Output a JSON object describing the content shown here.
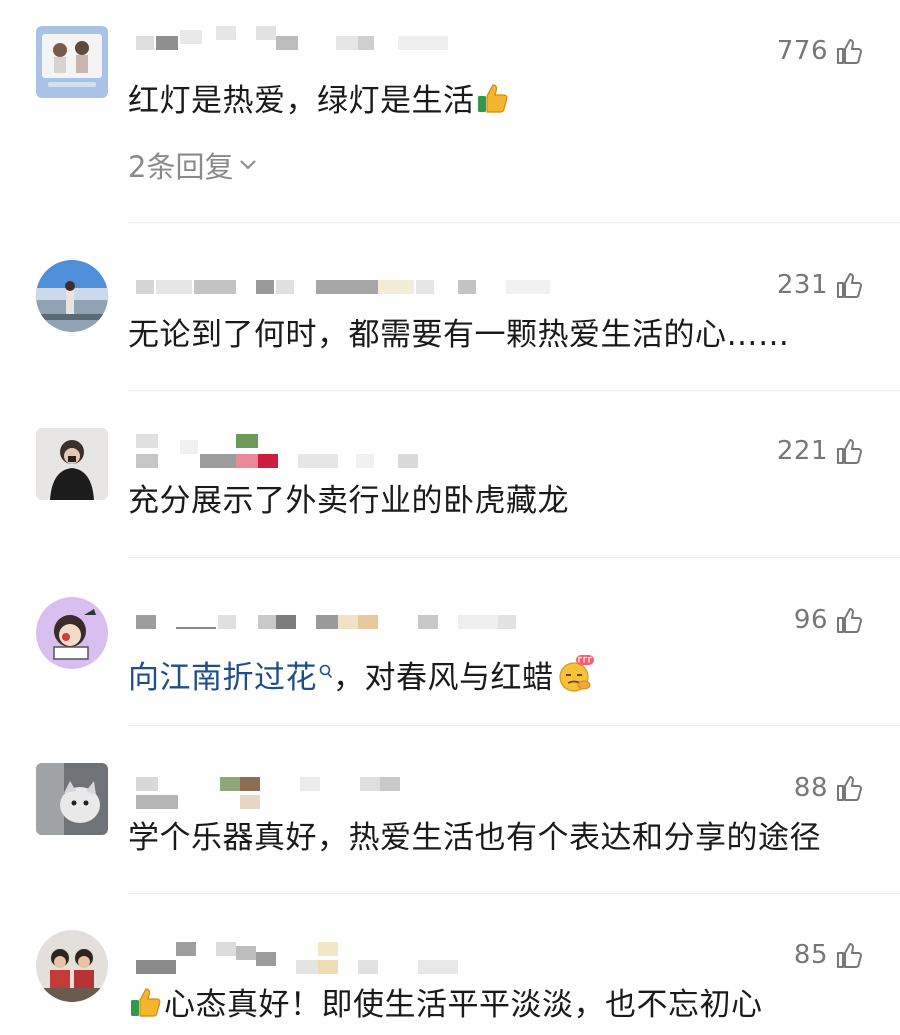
{
  "comments": [
    {
      "username": "",
      "likes": "776",
      "text": "红灯是热爱，绿灯是生活",
      "replies": "2条回复",
      "avatar_icon": "couple-photo-avatar"
    },
    {
      "username": "",
      "likes": "231",
      "text": "无论到了何时，都需要有一颗热爱生活的心……",
      "avatar_icon": "seaside-photo-avatar"
    },
    {
      "username": "",
      "likes": "221",
      "text": "充分展示了外卖行业的卧虎藏龙",
      "avatar_icon": "person-photo-avatar"
    },
    {
      "username": "",
      "likes": "96",
      "text_link": "向江南折过花",
      "text_rest": "，对春风与红蜡",
      "avatar_icon": "cartoon-girl-avatar"
    },
    {
      "username": "",
      "likes": "88",
      "text": "学个乐器真好，热爱生活也有个表达和分享的途径",
      "avatar_icon": "cat-photo-avatar"
    },
    {
      "username": "",
      "likes": "85",
      "text": "心态真好！即使生活平平淡淡，也不忘初心",
      "avatar_icon": "kids-photo-avatar"
    }
  ],
  "colors": {
    "text": "#1a1a1a",
    "muted": "#777777",
    "link": "#1e4f8a",
    "divider": "#ececec"
  }
}
